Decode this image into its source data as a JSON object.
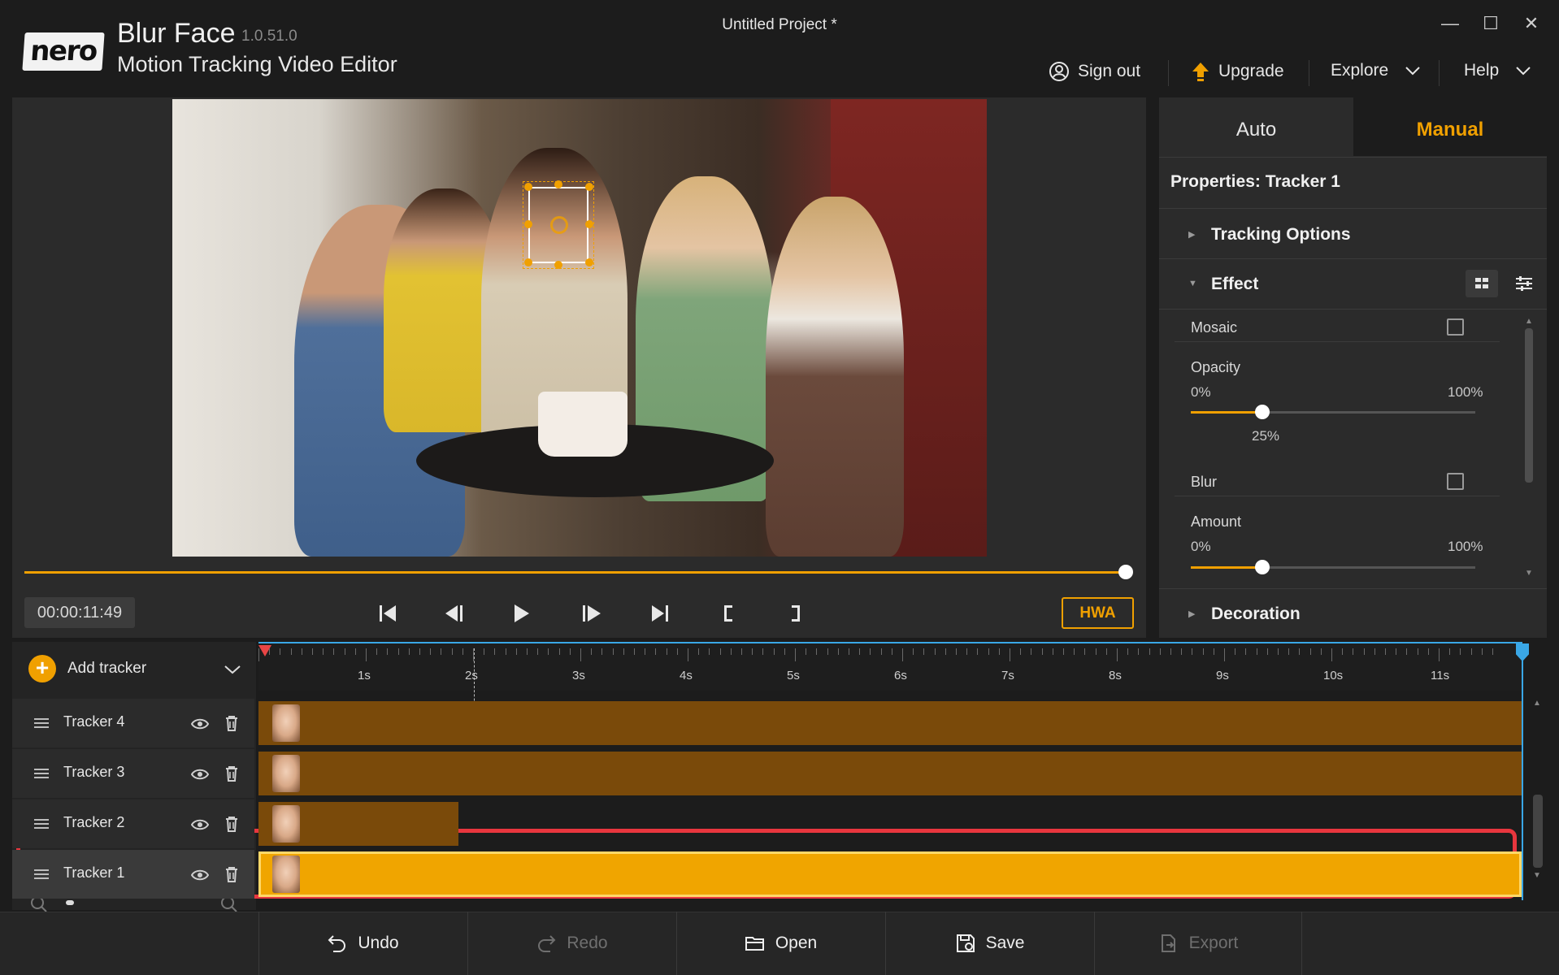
{
  "app": {
    "logo_text": "nero",
    "name": "Blur Face",
    "version": "1.0.51.0",
    "subtitle": "Motion Tracking Video Editor",
    "project_title": "Untitled Project *"
  },
  "window_controls": {
    "minimize": "—",
    "maximize": "☐",
    "close": "✕"
  },
  "top_menu": {
    "sign_out": "Sign out",
    "upgrade": "Upgrade",
    "explore": "Explore",
    "help": "Help"
  },
  "player": {
    "timecode": "00:00:11:49",
    "hwa_label": "HWA",
    "seek_progress_percent": 100
  },
  "right_panel": {
    "tabs": [
      {
        "label": "Auto",
        "active": false
      },
      {
        "label": "Manual",
        "active": true
      }
    ],
    "properties_title": "Properties:  Tracker 1",
    "sections": {
      "tracking_options": "Tracking Options",
      "effect": "Effect",
      "decoration": "Decoration"
    },
    "effect": {
      "mosaic_label": "Mosaic",
      "mosaic_checked": false,
      "opacity_label": "Opacity",
      "opacity_min": "0%",
      "opacity_max": "100%",
      "opacity_value": "25%",
      "opacity_fraction": 0.25,
      "blur_label": "Blur",
      "blur_checked": false,
      "amount_label": "Amount",
      "amount_min": "0%",
      "amount_max": "100%",
      "amount_fraction": 0.25
    }
  },
  "timeline": {
    "add_tracker_label": "Add tracker",
    "ruler_labels": [
      "1s",
      "2s",
      "3s",
      "4s",
      "5s",
      "6s",
      "7s",
      "8s",
      "9s",
      "10s",
      "11s"
    ],
    "tracks": [
      {
        "name": "Tracker 4",
        "clip_end_fraction": 1.0,
        "selected": false
      },
      {
        "name": "Tracker 3",
        "clip_end_fraction": 1.0,
        "selected": false
      },
      {
        "name": "Tracker 2",
        "clip_end_fraction": 0.158,
        "selected": false
      },
      {
        "name": "Tracker 1",
        "clip_end_fraction": 1.0,
        "selected": true
      }
    ]
  },
  "bottom_bar": {
    "undo": "Undo",
    "redo": "Redo",
    "open": "Open",
    "save": "Save",
    "export": "Export"
  },
  "colors": {
    "accent": "#f0a000",
    "clip_dim": "#7a4a0a",
    "clip_selected": "#f0a500",
    "playhead": "#3aa7e6",
    "selection_frame": "#e8363e"
  }
}
